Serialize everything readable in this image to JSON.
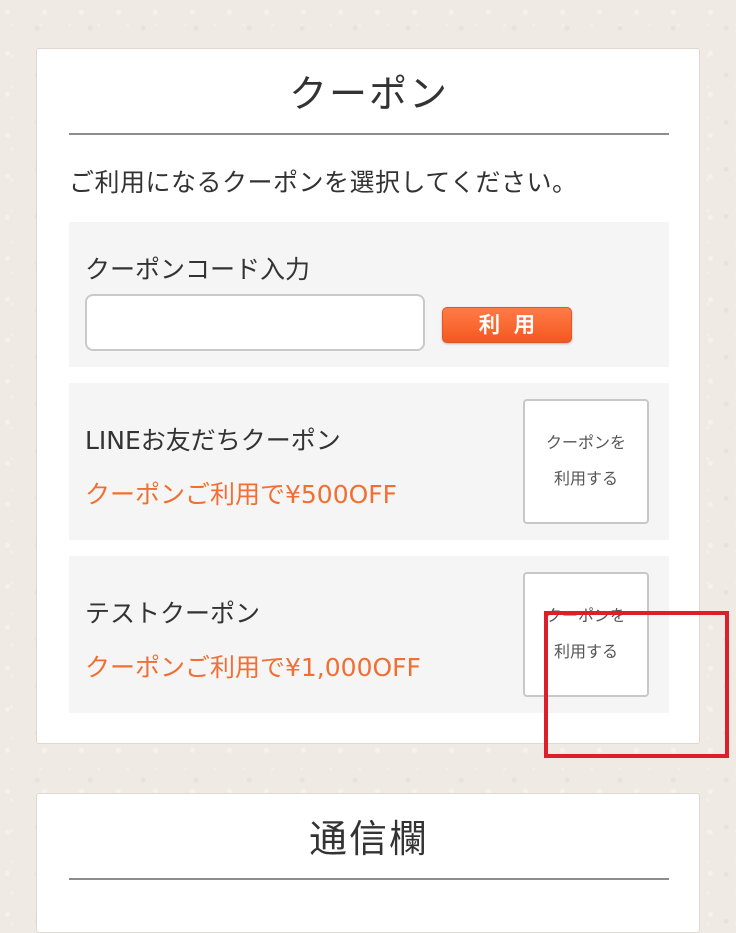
{
  "coupon_section": {
    "title": "クーポン",
    "instruction": "ご利用になるクーポンを選択してください。",
    "code_entry": {
      "label": "クーポンコード入力",
      "input_value": "",
      "apply_label": "利用"
    },
    "coupons": [
      {
        "name": "LINEお友だちクーポン",
        "discount": "クーポンご利用で¥500OFF",
        "button_line1": "クーポンを",
        "button_line2": "利用する"
      },
      {
        "name": "テストクーポン",
        "discount": "クーポンご利用で¥1,000OFF",
        "button_line1": "クーポンを",
        "button_line2": "利用する"
      }
    ]
  },
  "message_section": {
    "title": "通信欄"
  },
  "colors": {
    "accent_orange": "#f07033",
    "button_orange": "#f4581f",
    "highlight_red": "#dc1f2a",
    "card_bg": "#f5f5f5"
  }
}
